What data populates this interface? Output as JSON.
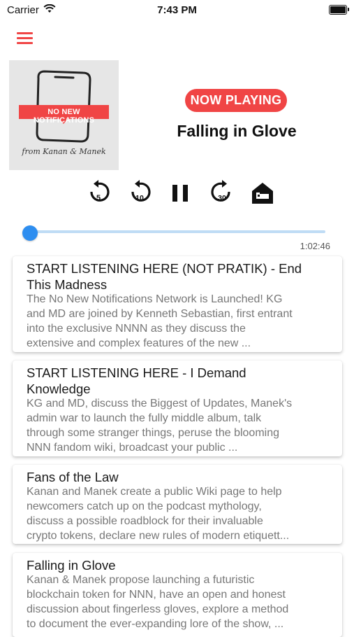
{
  "status_bar": {
    "carrier": "Carrier",
    "time": "7:43 PM"
  },
  "artwork": {
    "title": "NO NEW NOTIFICATIONS",
    "caption": "from Kanan & Manek"
  },
  "player": {
    "badge": "NOW PLAYING",
    "title": "Falling in Glove",
    "skip_back_5": "5",
    "skip_back_10": "10",
    "skip_forward_30": "30",
    "duration": "1:02:46",
    "progress": 0.0
  },
  "colors": {
    "accent": "#f04545",
    "slider": "#2e8ef0",
    "slider_track": "#bfdcf5"
  },
  "episodes": [
    {
      "title": "START LISTENING HERE (NOT PRATIK) - End\nThis Madness",
      "description": "The No New Notifications Network is Launched! KG\nand MD are joined by Kenneth Sebastian, first entrant\ninto the exclusive NNNN as they discuss the\nextensive and complex features of the new ..."
    },
    {
      "title": "START LISTENING HERE - I Demand\nKnowledge",
      "description": "KG and MD, discuss the Biggest of Updates, Manek's\nadmin war to launch the fully middle album, talk\nthrough some stranger things, peruse the blooming\nNNN fandom wiki, broadcast your public ..."
    },
    {
      "title": "Fans of the Law",
      "description": "Kanan and Manek create a public Wiki page to help\nnewcomers catch up on the podcast mythology,\ndiscuss a possible roadblock for their invaluable\ncrypto tokens, declare new rules of modern etiquett..."
    },
    {
      "title": "Falling in Glove",
      "description": "Kanan & Manek propose launching a futuristic\nblockchain token for NNN, have an open and honest\ndiscussion about fingerless gloves, explore a method\nto document the ever-expanding lore of the show, ..."
    }
  ]
}
